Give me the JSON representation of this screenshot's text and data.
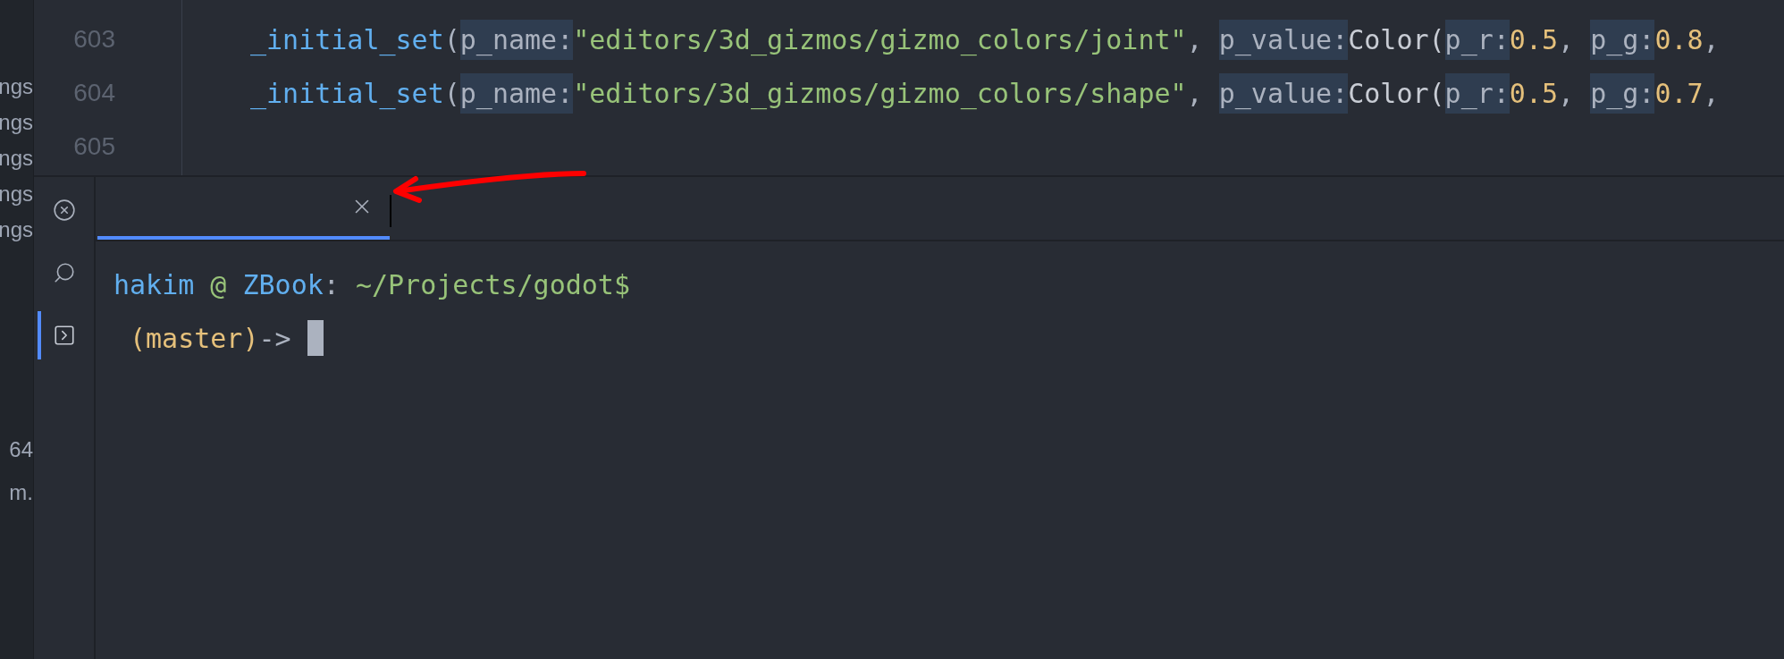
{
  "sidebar": {
    "groups": [
      [
        "ngs",
        "ngs",
        "ngs",
        "ngs",
        "ngs"
      ],
      [
        "64",
        "m."
      ]
    ]
  },
  "editor": {
    "lines": [
      {
        "number": "603",
        "tokens": [
          {
            "kind": "fn",
            "text": "_initial_set"
          },
          {
            "kind": "punct",
            "text": "("
          },
          {
            "kind": "param",
            "text": "p_name:"
          },
          {
            "kind": "string",
            "text": "\"editors/3d_gizmos/gizmo_colors/joint\""
          },
          {
            "kind": "punct",
            "text": ", "
          },
          {
            "kind": "param",
            "text": "p_value:"
          },
          {
            "kind": "type",
            "text": "Color("
          },
          {
            "kind": "param",
            "text": "p_r:"
          },
          {
            "kind": "number",
            "text": "0.5"
          },
          {
            "kind": "punct",
            "text": ", "
          },
          {
            "kind": "param",
            "text": "p_g:"
          },
          {
            "kind": "number",
            "text": "0.8"
          },
          {
            "kind": "punct",
            "text": ","
          }
        ]
      },
      {
        "number": "604",
        "tokens": [
          {
            "kind": "fn",
            "text": "_initial_set"
          },
          {
            "kind": "punct",
            "text": "("
          },
          {
            "kind": "param",
            "text": "p_name:"
          },
          {
            "kind": "string",
            "text": "\"editors/3d_gizmos/gizmo_colors/shape\""
          },
          {
            "kind": "punct",
            "text": ", "
          },
          {
            "kind": "param",
            "text": "p_value:"
          },
          {
            "kind": "type",
            "text": "Color("
          },
          {
            "kind": "param",
            "text": "p_r:"
          },
          {
            "kind": "number",
            "text": "0.5"
          },
          {
            "kind": "punct",
            "text": ", "
          },
          {
            "kind": "param",
            "text": "p_g:"
          },
          {
            "kind": "number",
            "text": "0.7"
          },
          {
            "kind": "punct",
            "text": ","
          }
        ]
      },
      {
        "number": "605"
      }
    ]
  },
  "panel": {
    "side_buttons": [
      {
        "kind": "close",
        "selected": false
      },
      {
        "kind": "search",
        "selected": false
      },
      {
        "kind": "terminal",
        "selected": true
      }
    ],
    "tabs": [
      {
        "selected": true
      }
    ],
    "terminal": {
      "lines": [
        {
          "indent": false,
          "cursor": false,
          "tokens": [
            {
              "kind": "user",
              "text": "hakim"
            },
            {
              "kind": "green",
              "text": " @ "
            },
            {
              "kind": "user",
              "text": "ZBook"
            },
            {
              "kind": "punct",
              "text": ": "
            },
            {
              "kind": "green",
              "text": "~/Projects/godot$"
            }
          ]
        },
        {
          "indent": true,
          "cursor": true,
          "tokens": [
            {
              "kind": "branch",
              "text": "(master)"
            },
            {
              "kind": "punct",
              "text": "-> "
            }
          ]
        }
      ]
    }
  }
}
